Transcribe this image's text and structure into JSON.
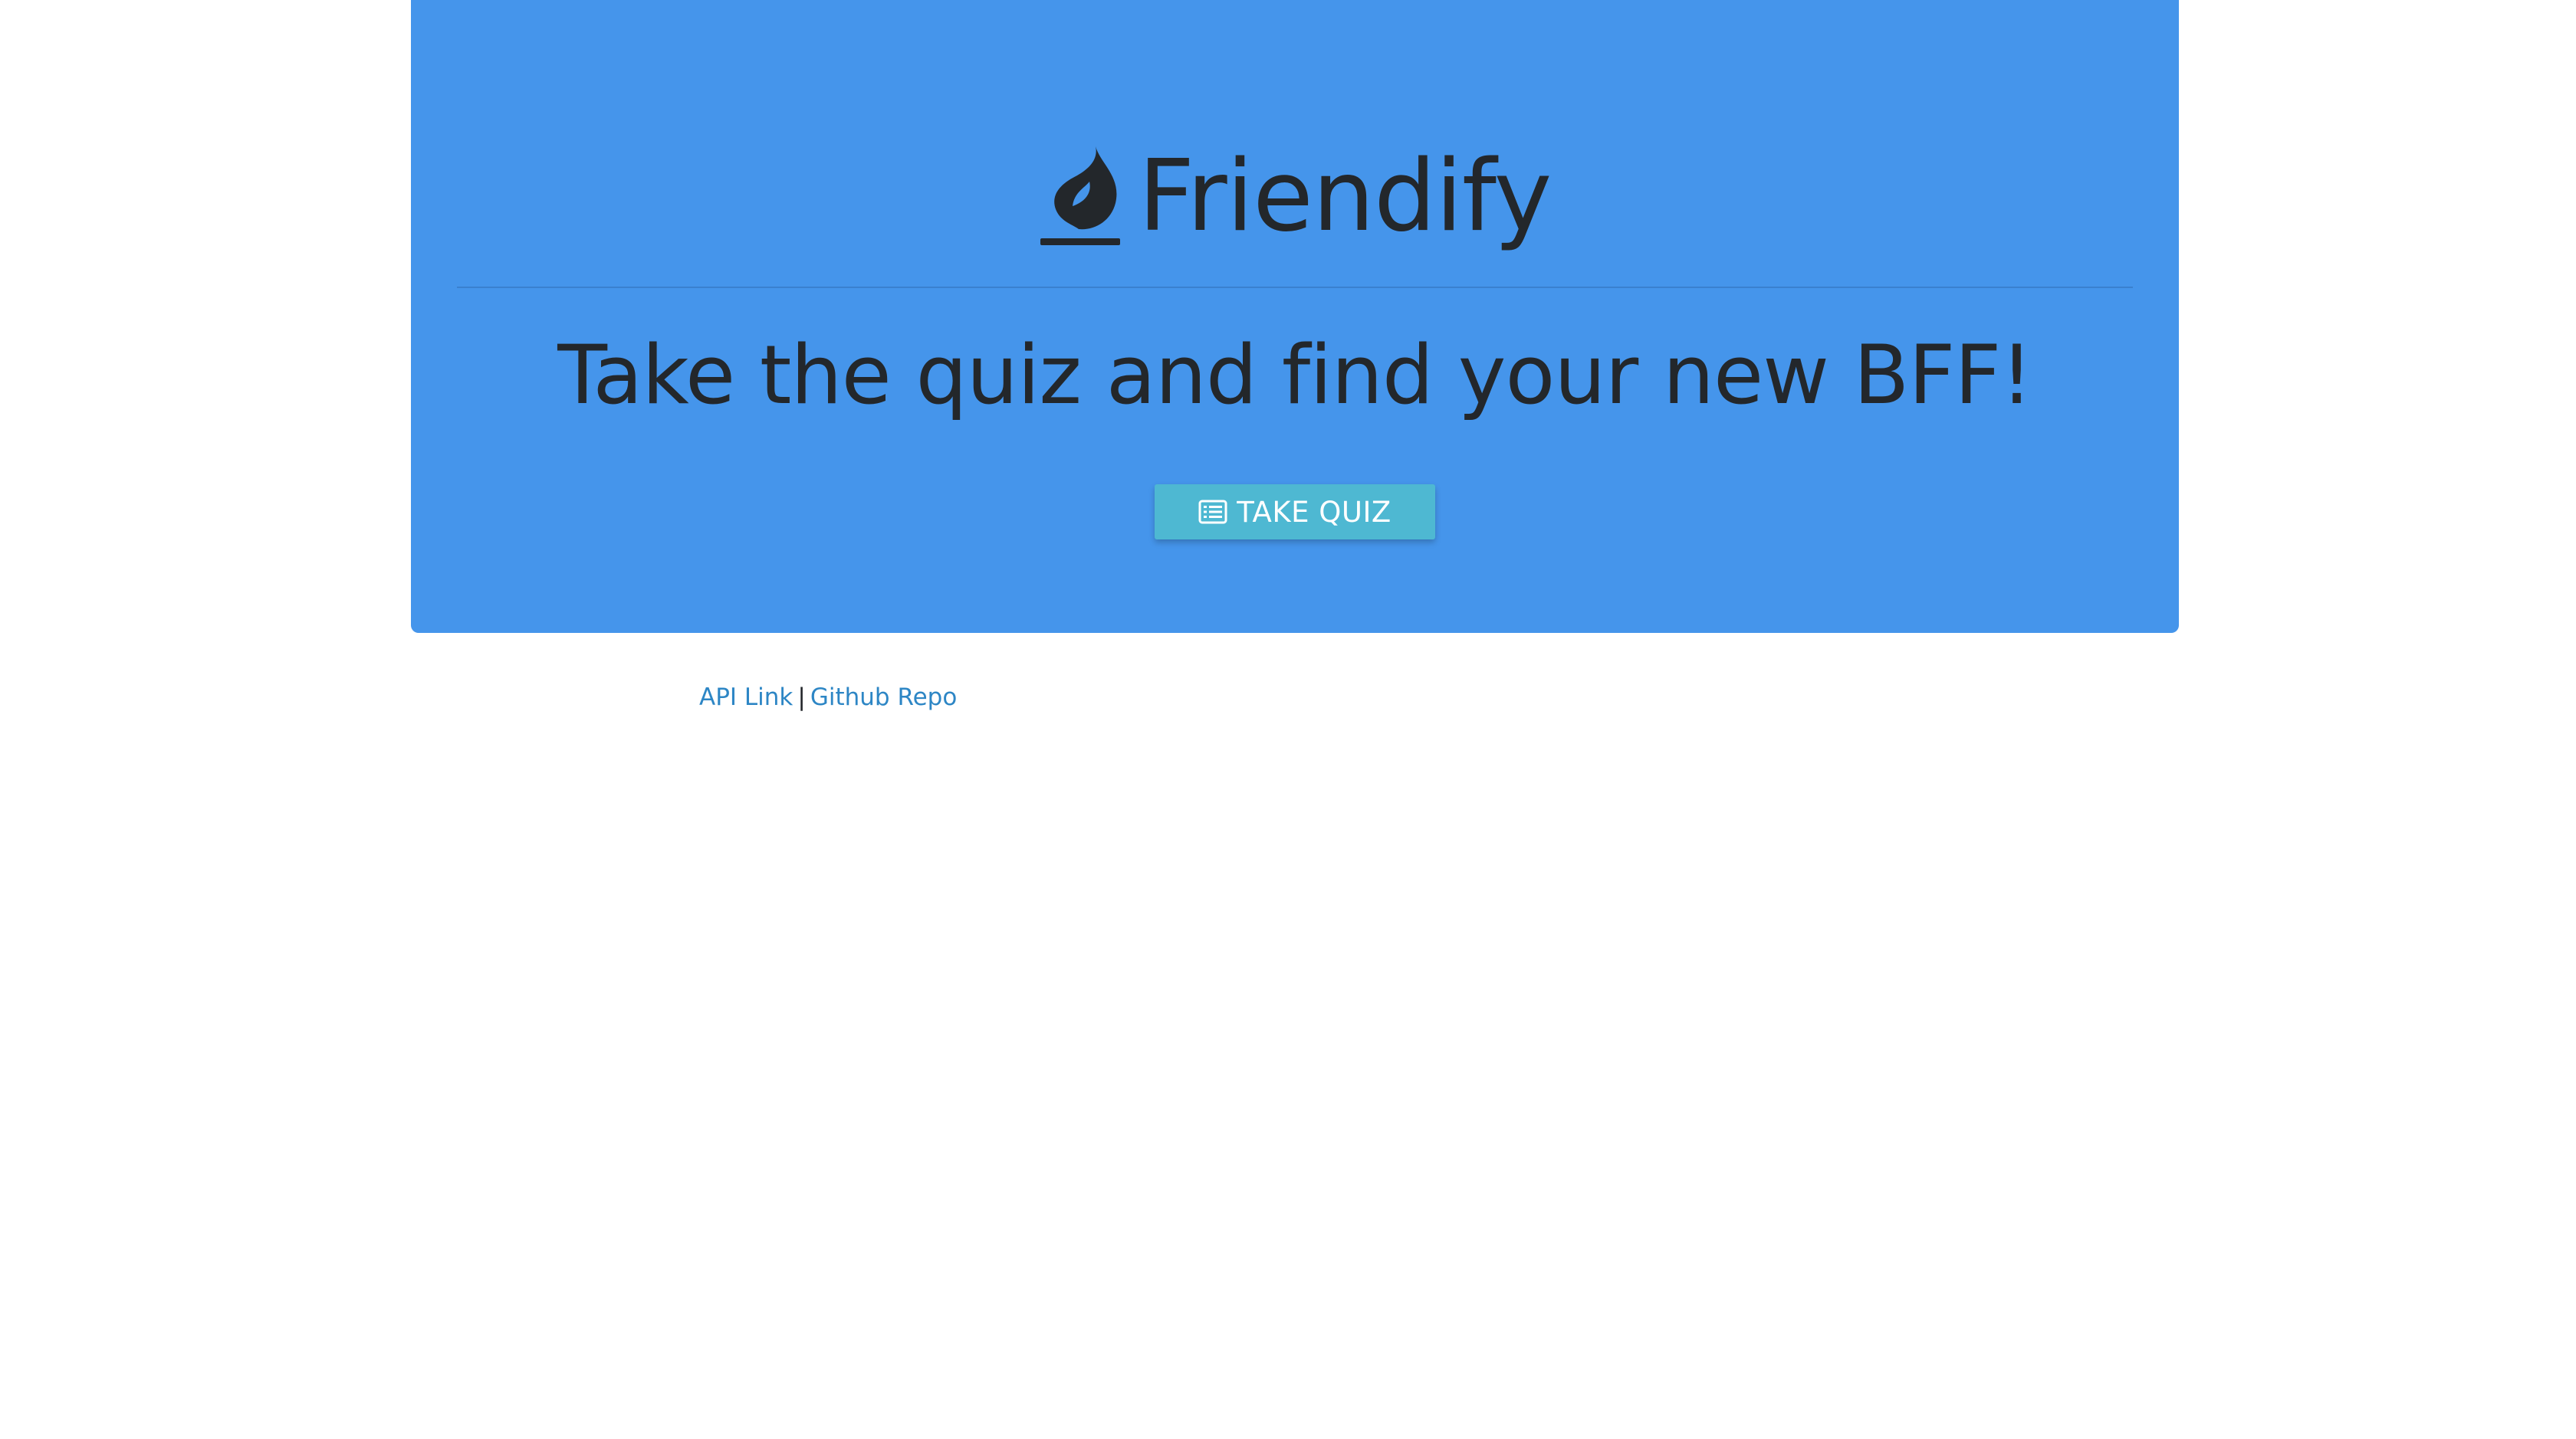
{
  "hero": {
    "brand_name": "Friendify",
    "brand_icon": "fire-icon",
    "headline": "Take the quiz and find your new BFF!",
    "cta_label": "TAKE QUIZ",
    "cta_icon": "list-alt-icon"
  },
  "footer": {
    "api_link_label": "API Link",
    "separator": "|",
    "github_link_label": "Github Repo"
  },
  "colors": {
    "hero_background": "#4595eb",
    "cta_background": "#4eb8d2",
    "link": "#2d86c5",
    "text_dark": "#23272b"
  }
}
